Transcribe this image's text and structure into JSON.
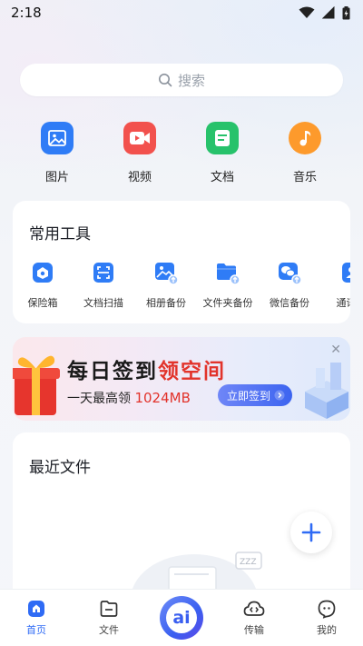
{
  "status_bar": {
    "time": "2:18"
  },
  "search": {
    "placeholder": "搜索"
  },
  "categories": [
    {
      "label": "图片",
      "icon": "image-icon",
      "color": "#2f7cf6"
    },
    {
      "label": "视频",
      "icon": "video-icon",
      "color": "#f2514d"
    },
    {
      "label": "文档",
      "icon": "document-icon",
      "color": "#27c26b"
    },
    {
      "label": "音乐",
      "icon": "music-icon",
      "color": "#fd9a2c"
    }
  ],
  "tools": {
    "title": "常用工具",
    "items": [
      {
        "label": "保险箱",
        "icon": "safe-box-icon"
      },
      {
        "label": "文档扫描",
        "icon": "scan-icon"
      },
      {
        "label": "相册备份",
        "icon": "album-backup-icon"
      },
      {
        "label": "文件夹备份",
        "icon": "folder-backup-icon"
      },
      {
        "label": "微信备份",
        "icon": "wechat-backup-icon"
      },
      {
        "label": "通讯录",
        "icon": "contacts-icon"
      }
    ]
  },
  "banner": {
    "title_part1": "每日签到",
    "title_part2": "领空间",
    "subtitle_part1": "一天最高领 ",
    "subtitle_amount": "1024MB",
    "button_label": "立即签到",
    "close_label": "✕"
  },
  "recent": {
    "title": "最近文件"
  },
  "tabbar": {
    "home": "首页",
    "files": "文件",
    "ai_label": "ai",
    "transfer": "传输",
    "mine": "我的"
  },
  "colors": {
    "accent": "#2f6bf5",
    "highlight": "#e2332b"
  }
}
